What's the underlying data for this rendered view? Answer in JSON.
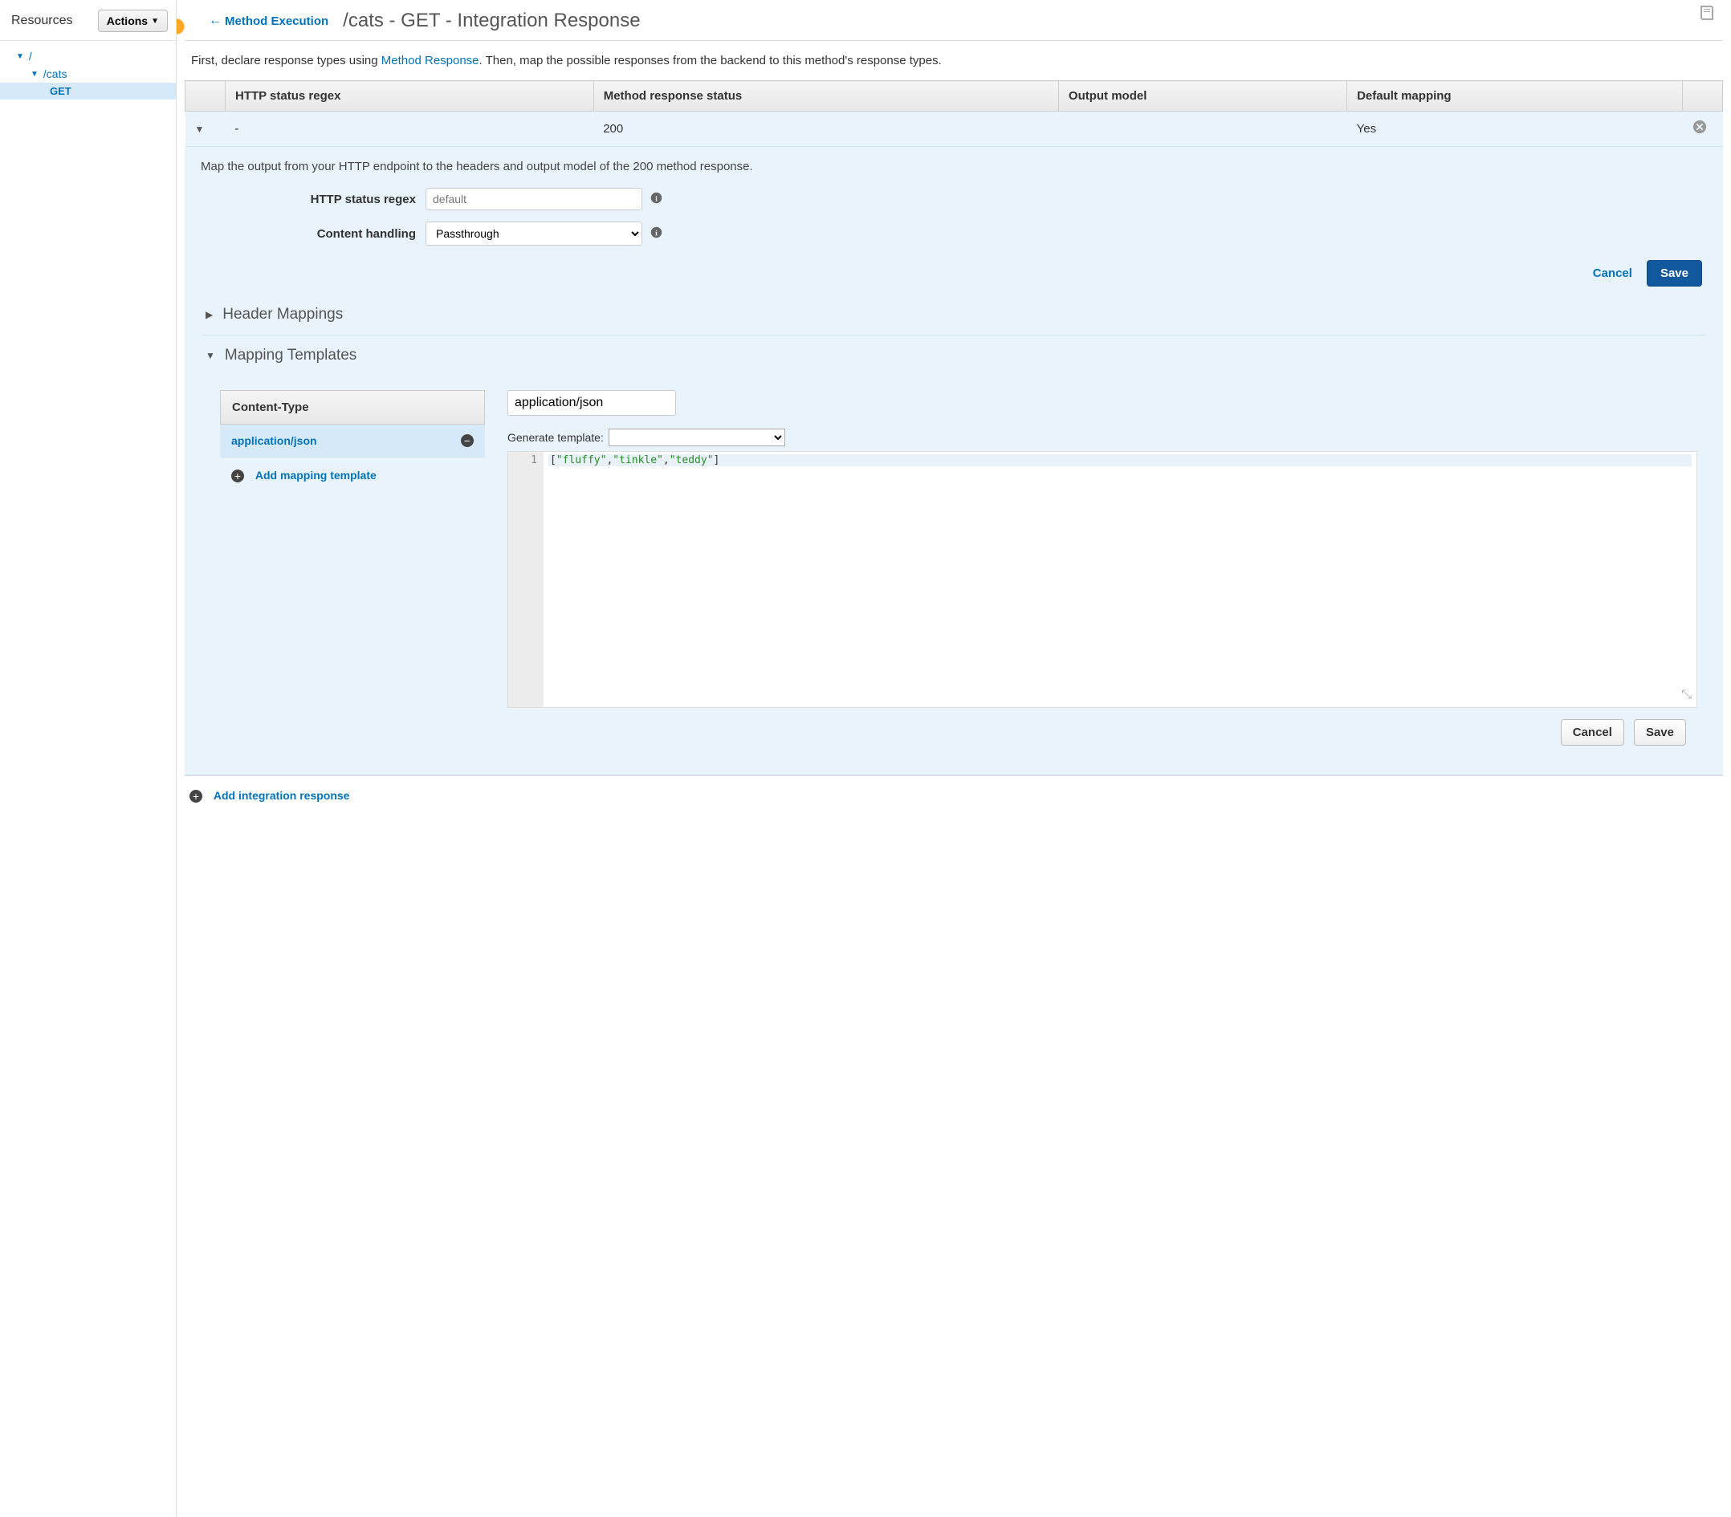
{
  "sidebar": {
    "title": "Resources",
    "actions_label": "Actions",
    "tree": {
      "root": "/",
      "child": "/cats",
      "method": "GET"
    }
  },
  "header": {
    "back_label": "Method Execution",
    "title": "/cats - GET - Integration Response"
  },
  "intro": {
    "pre": "First, declare response types using ",
    "link": "Method Response",
    "post": ". Then, map the possible responses from the backend to this method's response types."
  },
  "table": {
    "cols": {
      "regex": "HTTP status regex",
      "method_status": "Method response status",
      "output_model": "Output model",
      "default_mapping": "Default mapping"
    },
    "row": {
      "regex": "-",
      "method_status": "200",
      "output_model": "",
      "default_mapping": "Yes"
    }
  },
  "panel": {
    "desc": "Map the output from your HTTP endpoint to the headers and output model of the 200 method response.",
    "regex_label": "HTTP status regex",
    "regex_placeholder": "default",
    "content_label": "Content handling",
    "content_value": "Passthrough",
    "cancel": "Cancel",
    "save": "Save"
  },
  "sections": {
    "header_mappings": "Header Mappings",
    "mapping_templates": "Mapping Templates"
  },
  "mapping": {
    "ct_header": "Content-Type",
    "ct_item": "application/json",
    "add_template": "Add mapping template",
    "ct_input_value": "application/json",
    "generate_label": "Generate template:",
    "code_line_no": "1",
    "code_tokens": {
      "open": "[",
      "s1": "\"fluffy\"",
      "c1": ",",
      "s2": "\"tinkle\"",
      "c2": ",",
      "s3": "\"teddy\"",
      "close": "]"
    },
    "cancel": "Cancel",
    "save": "Save"
  },
  "footer": {
    "add_integration": "Add integration response"
  }
}
